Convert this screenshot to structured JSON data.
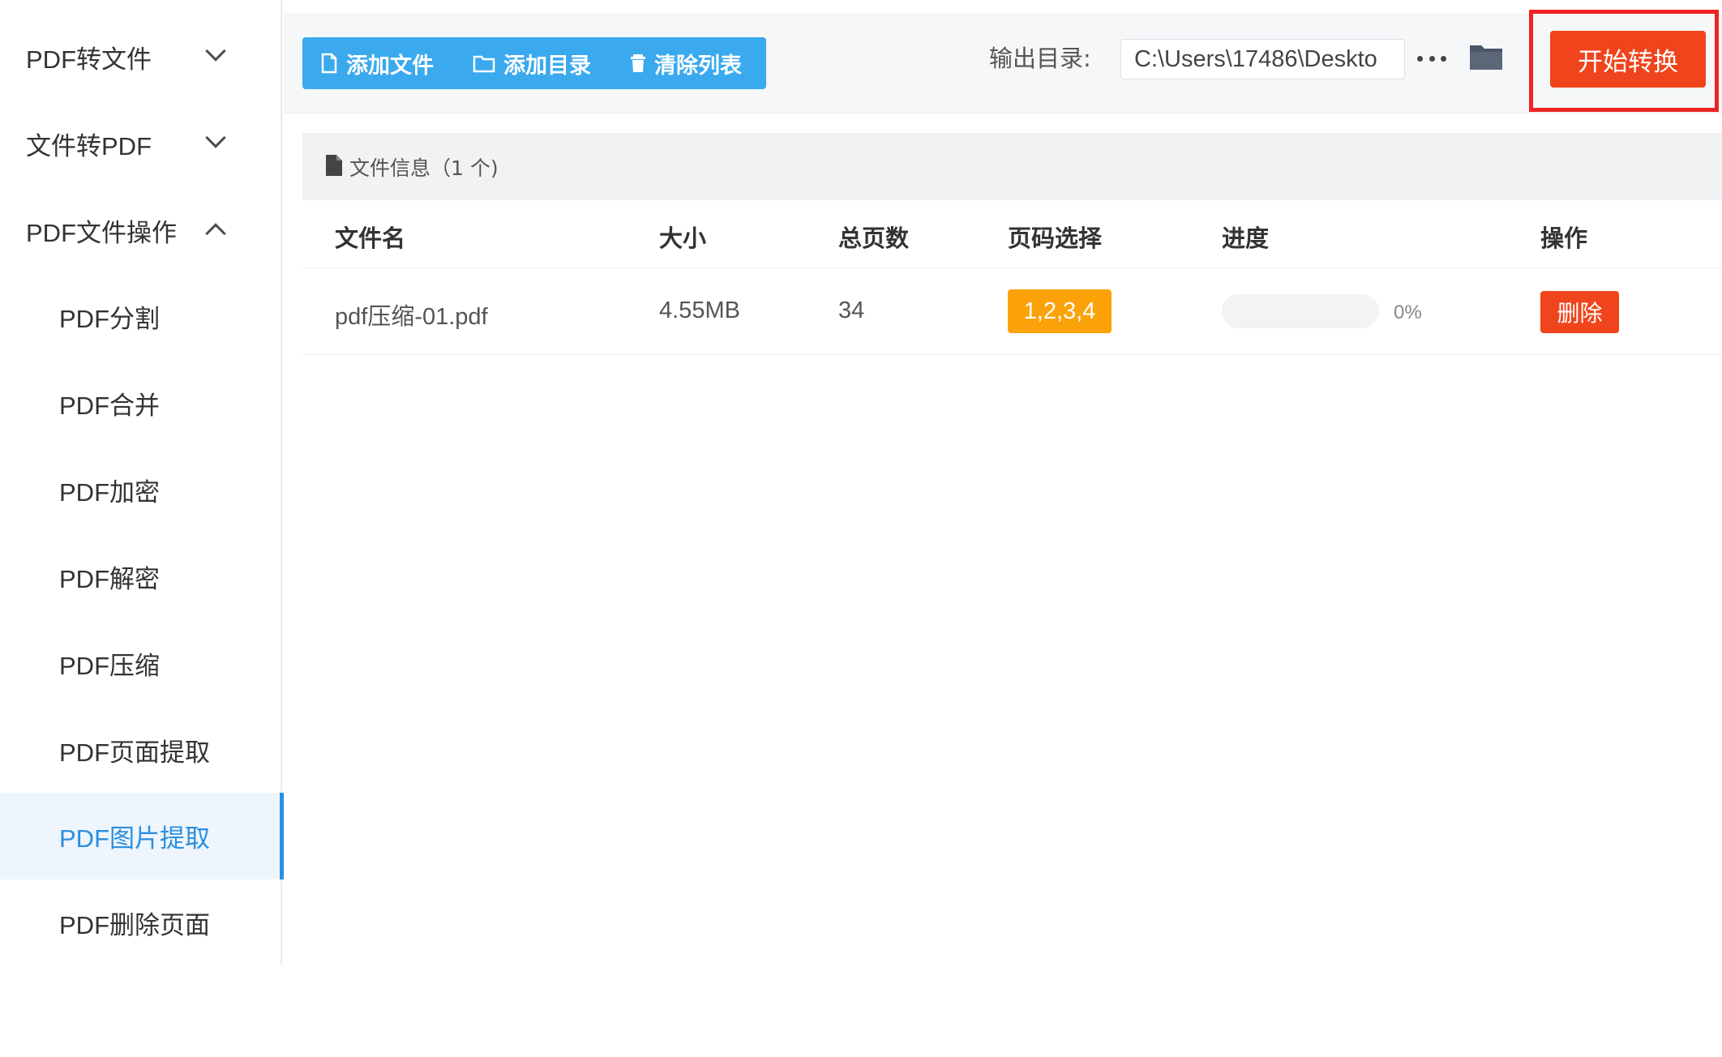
{
  "sidebar": {
    "groups": [
      {
        "label": "PDF转文件",
        "state": "collapsed"
      },
      {
        "label": "文件转PDF",
        "state": "collapsed"
      },
      {
        "label": "PDF文件操作",
        "state": "expanded"
      }
    ],
    "items": [
      {
        "label": "PDF分割"
      },
      {
        "label": "PDF合并"
      },
      {
        "label": "PDF加密"
      },
      {
        "label": "PDF解密"
      },
      {
        "label": "PDF压缩"
      },
      {
        "label": "PDF页面提取"
      },
      {
        "label": "PDF图片提取"
      },
      {
        "label": "PDF删除页面"
      }
    ],
    "active_item": "PDF图片提取"
  },
  "toolbar": {
    "add_file_label": "添加文件",
    "add_dir_label": "添加目录",
    "clear_list_label": "清除列表",
    "output_label": "输出目录:",
    "output_path": "C:\\Users\\17486\\Deskto",
    "start_label": "开始转换"
  },
  "file_panel": {
    "title": "文件信息（1 个)",
    "columns": [
      "文件名",
      "大小",
      "总页数",
      "页码选择",
      "进度",
      "操作"
    ],
    "rows": [
      {
        "name": "pdf压缩-01.pdf",
        "size": "4.55MB",
        "pages": "34",
        "page_selection": "1,2,3,4",
        "progress_text": "0%",
        "progress_value": 0,
        "action_label": "删除"
      }
    ]
  },
  "colors": {
    "primary_blue": "#3aa9ee",
    "active_blue": "#2b8fdf",
    "start_red": "#f0441c",
    "badge_orange": "#fba209",
    "annotation_red": "#ee2323"
  },
  "icons": {
    "chevron_collapsed": "chevron-down-icon",
    "chevron_expanded": "chevron-up-icon",
    "add_file": "file-icon",
    "add_dir": "folder-outline-icon",
    "clear_list": "trash-icon",
    "more": "ellipsis-icon",
    "browse": "folder-icon",
    "file_info": "document-icon"
  }
}
